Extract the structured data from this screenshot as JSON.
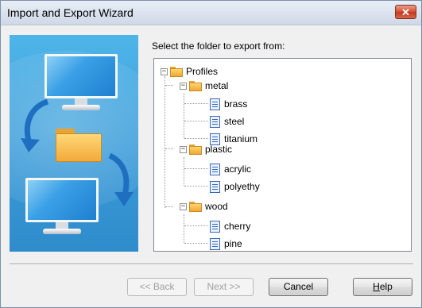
{
  "window": {
    "title": "Import and Export Wizard",
    "close_glyph": "✕"
  },
  "prompt": "Select the folder to export from:",
  "tree": {
    "root": "Profiles",
    "folders": [
      {
        "label": "metal",
        "items": [
          "brass",
          "steel",
          "titanium"
        ]
      },
      {
        "label": "plastic",
        "items": [
          "acrylic",
          "polyethy"
        ]
      },
      {
        "label": "wood",
        "items": [
          "cherry",
          "pine"
        ]
      }
    ]
  },
  "buttons": {
    "back": "<< Back",
    "next": "Next >>",
    "cancel": "Cancel",
    "help_first": "H",
    "help_rest": "elp"
  },
  "colors": {
    "art_background": "#3a9bd8",
    "arrow": "#1f6fc0"
  }
}
